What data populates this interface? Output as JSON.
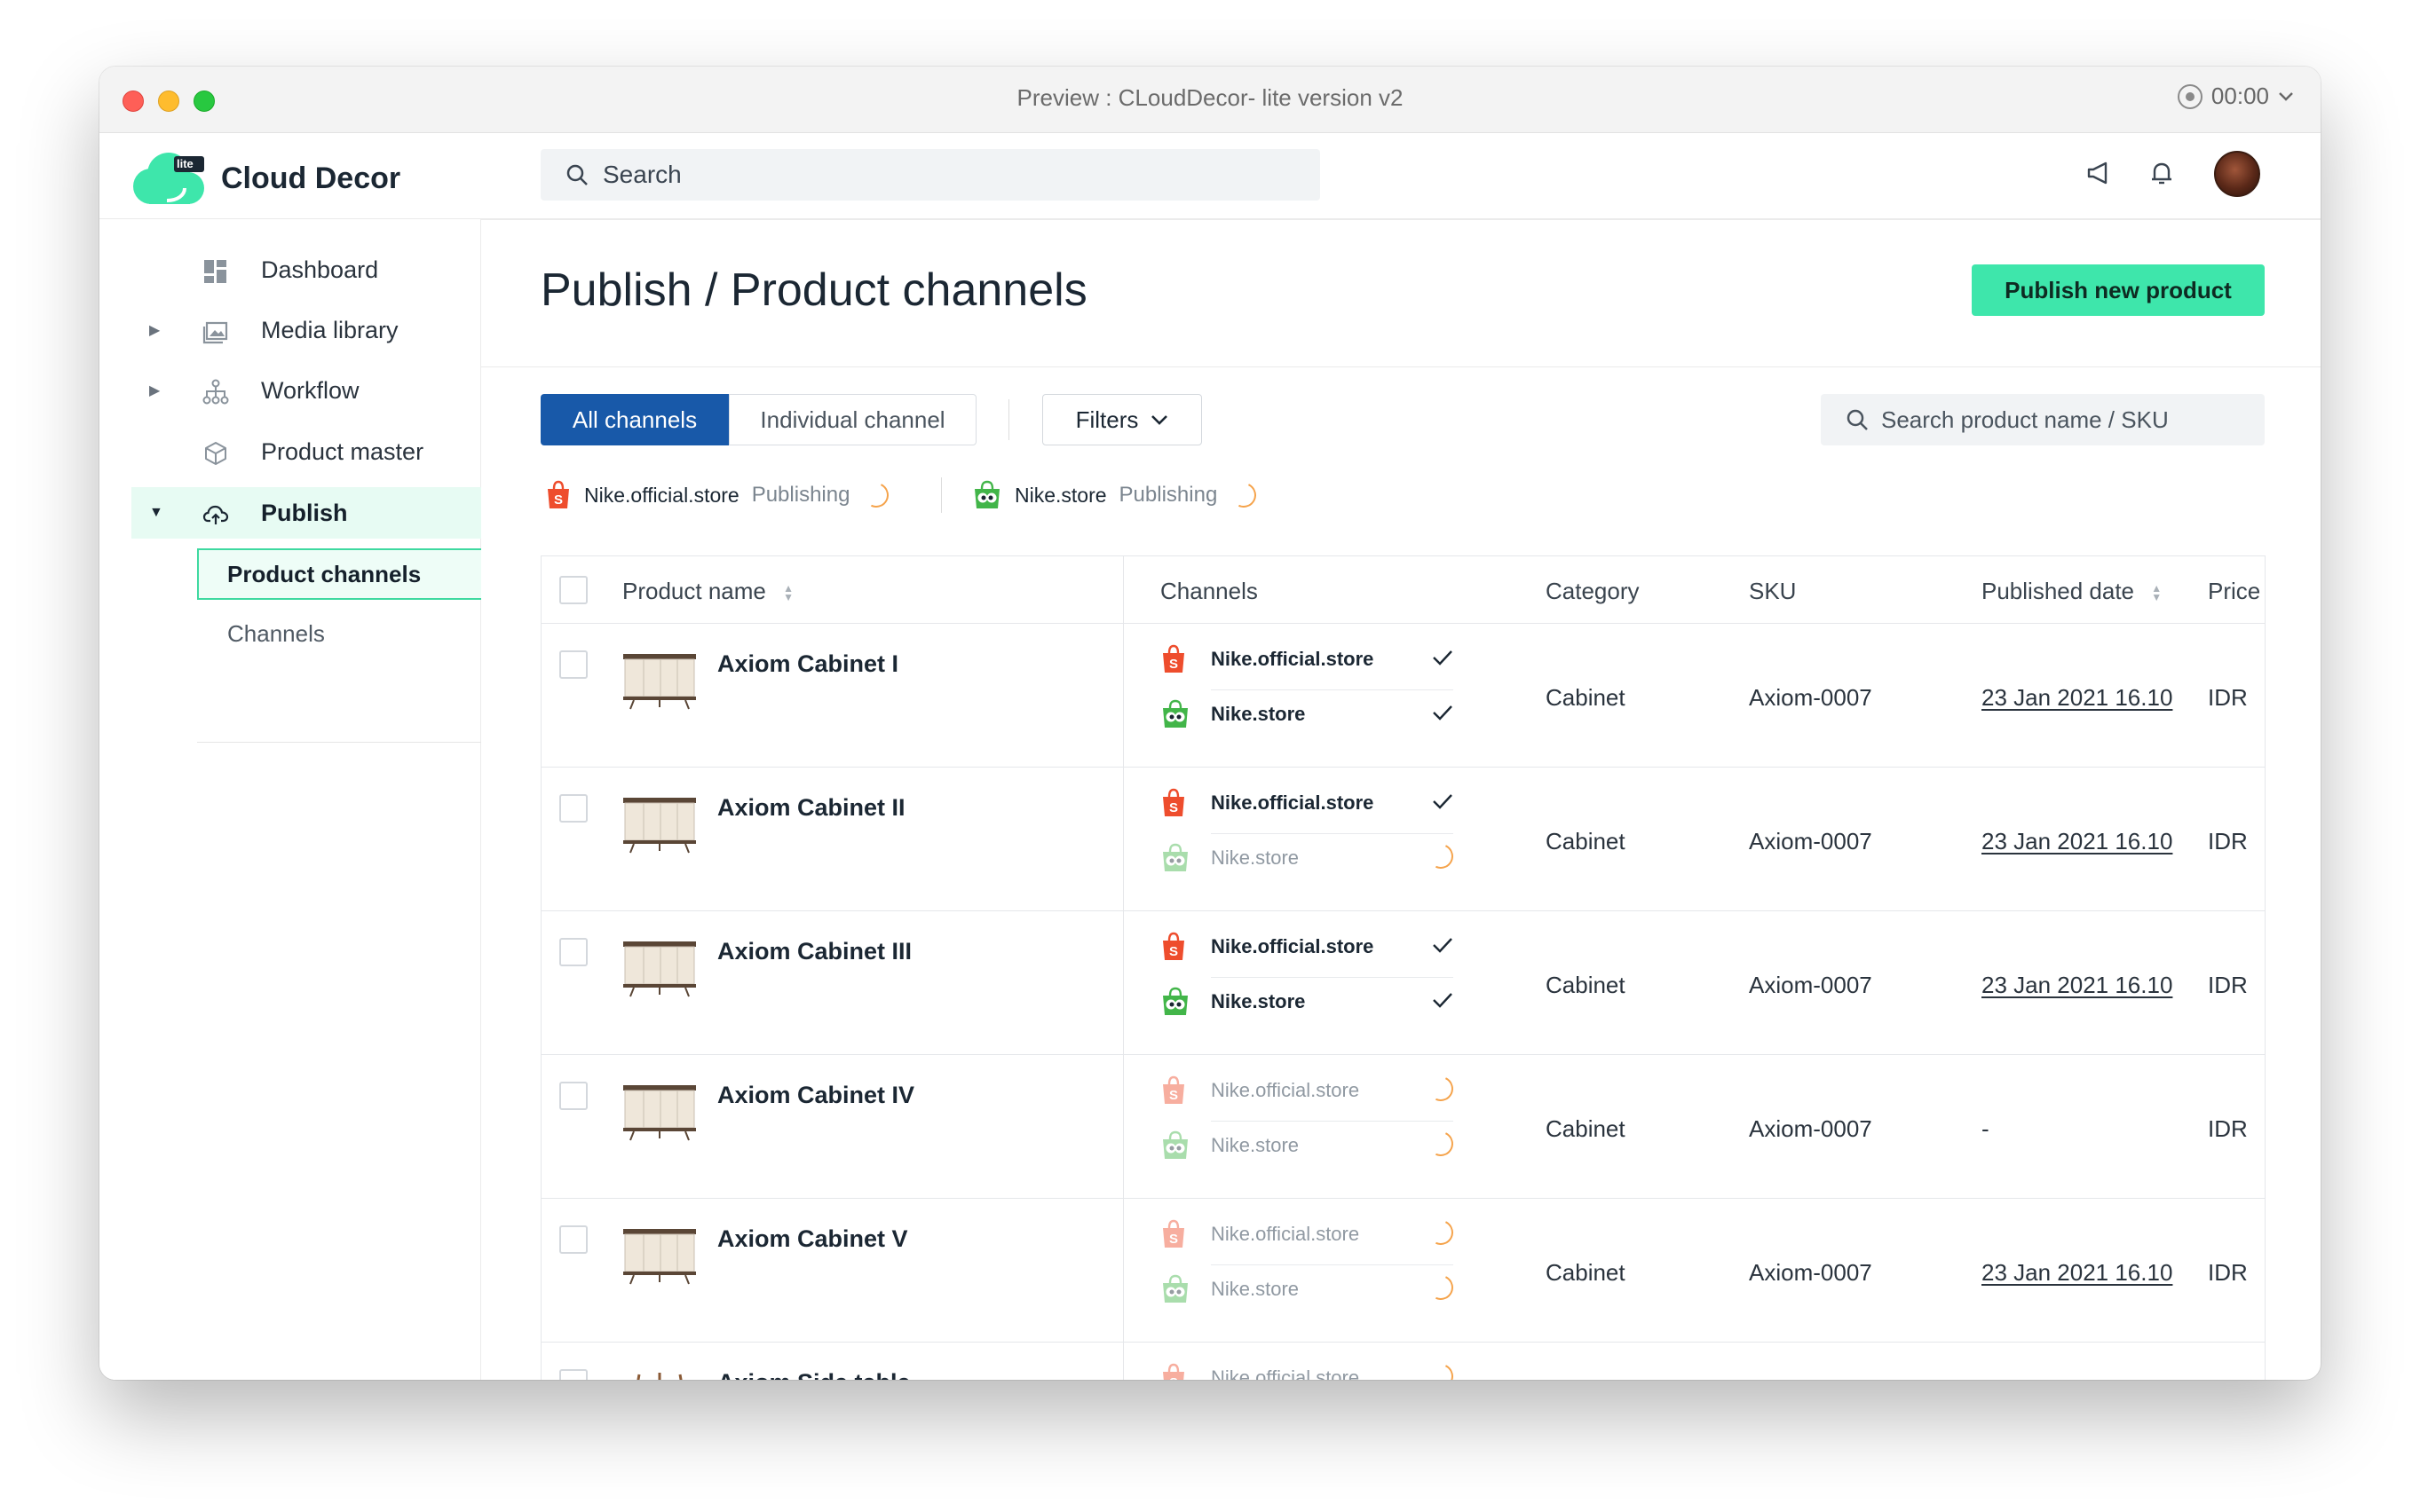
{
  "window": {
    "title": "Preview : CLoudDecor- lite version v2",
    "timer": "00:00"
  },
  "app": {
    "brand": "Cloud Decor",
    "badge": "lite"
  },
  "search": {
    "placeholder": "Search"
  },
  "sidebar": {
    "items": [
      {
        "label": "Dashboard",
        "icon": "dashboard-icon"
      },
      {
        "label": "Media library",
        "icon": "image-icon"
      },
      {
        "label": "Workflow",
        "icon": "workflow-icon"
      },
      {
        "label": "Product master",
        "icon": "cube-icon"
      },
      {
        "label": "Publish",
        "icon": "cloud-upload-icon"
      }
    ],
    "sub_items": [
      {
        "label": "Product channels"
      },
      {
        "label": "Channels"
      }
    ]
  },
  "page": {
    "title": "Publish / Product channels",
    "primary_button": "Publish new product"
  },
  "toolbar": {
    "tabs": [
      "All channels",
      "Individual channel"
    ],
    "filters_label": "Filters",
    "search_placeholder": "Search product name / SKU"
  },
  "publishing_status": [
    {
      "store": "Nike.official.store",
      "status": "Publishing",
      "icon": "shopee-icon"
    },
    {
      "store": "Nike.store",
      "status": "Publishing",
      "icon": "tokopedia-icon"
    }
  ],
  "table": {
    "columns": [
      "Product name",
      "Channels",
      "Category",
      "SKU",
      "Published date",
      "Price"
    ],
    "rows": [
      {
        "name": "Axiom Cabinet I",
        "channels": [
          {
            "store": "Nike.official.store",
            "state": "done"
          },
          {
            "store": "Nike.store",
            "state": "done"
          }
        ],
        "category": "Cabinet",
        "sku": "Axiom-0007",
        "date": "23 Jan 2021 16.10",
        "price": "IDR"
      },
      {
        "name": "Axiom Cabinet II",
        "channels": [
          {
            "store": "Nike.official.store",
            "state": "done"
          },
          {
            "store": "Nike.store",
            "state": "pending"
          }
        ],
        "category": "Cabinet",
        "sku": "Axiom-0007",
        "date": "23 Jan 2021 16.10",
        "price": "IDR"
      },
      {
        "name": "Axiom Cabinet III",
        "channels": [
          {
            "store": "Nike.official.store",
            "state": "done"
          },
          {
            "store": "Nike.store",
            "state": "done"
          }
        ],
        "category": "Cabinet",
        "sku": "Axiom-0007",
        "date": "23 Jan 2021 16.10",
        "price": "IDR"
      },
      {
        "name": "Axiom Cabinet IV",
        "channels": [
          {
            "store": "Nike.official.store",
            "state": "pending"
          },
          {
            "store": "Nike.store",
            "state": "pending"
          }
        ],
        "category": "Cabinet",
        "sku": "Axiom-0007",
        "date": "-",
        "price": "IDR"
      },
      {
        "name": "Axiom Cabinet V",
        "channels": [
          {
            "store": "Nike.official.store",
            "state": "pending"
          },
          {
            "store": "Nike.store",
            "state": "pending"
          }
        ],
        "category": "Cabinet",
        "sku": "Axiom-0007",
        "date": "23 Jan 2021 16.10",
        "price": "IDR"
      },
      {
        "name": "Axiom Side table",
        "channels": [
          {
            "store": "Nike.official.store",
            "state": "pending"
          }
        ],
        "category": "",
        "sku": "",
        "date": "",
        "price": ""
      }
    ]
  },
  "colors": {
    "accent": "#3ee6ab",
    "primary": "#1859a9",
    "shopee": "#ee4d2d",
    "tokopedia": "#42b549",
    "spinner": "#f5a34b"
  }
}
